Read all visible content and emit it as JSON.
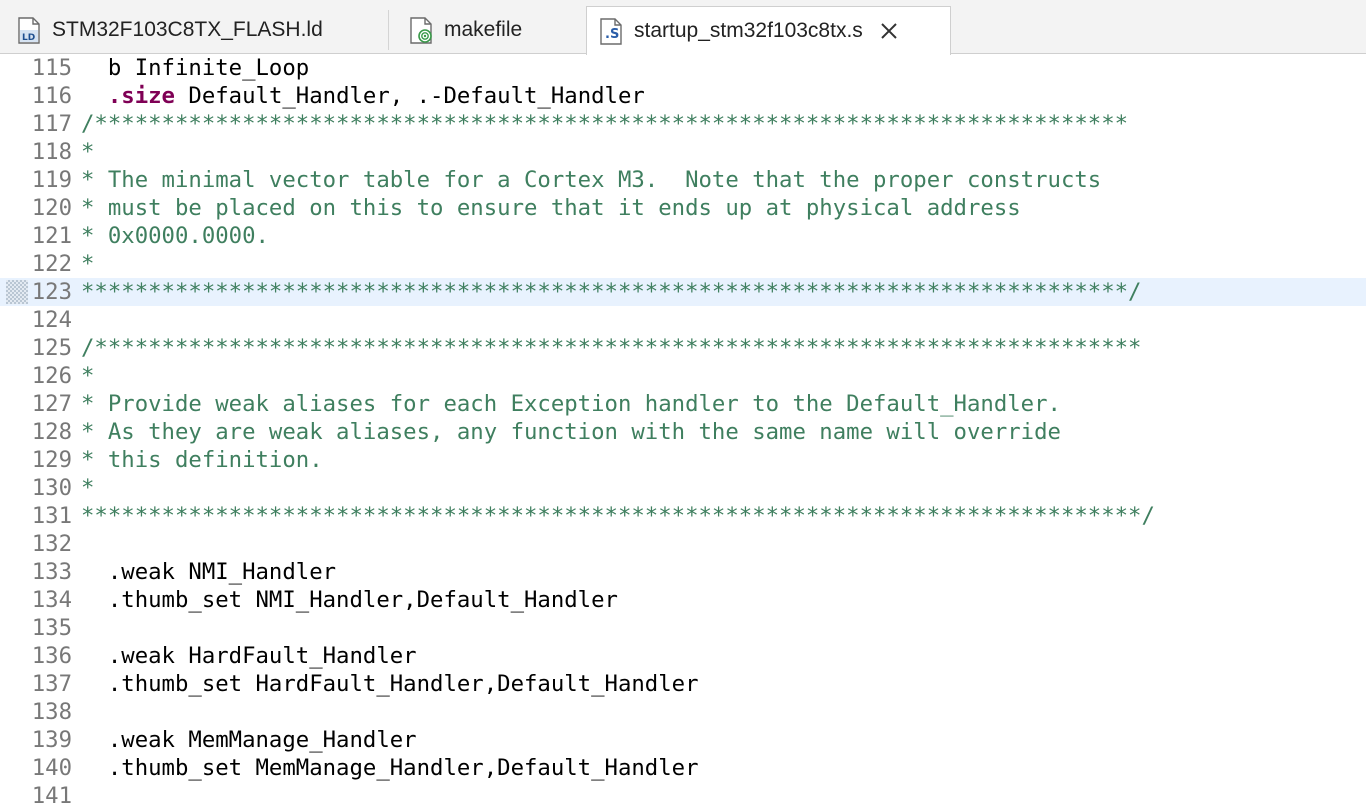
{
  "tabs": [
    {
      "label": "STM32F103C8TX_FLASH.ld",
      "icon": "linker-script-file-icon",
      "active": false
    },
    {
      "label": "makefile",
      "icon": "makefile-icon",
      "active": false
    },
    {
      "label": "startup_stm32f103c8tx.s",
      "icon": "assembly-file-icon",
      "active": true
    }
  ],
  "editor": {
    "current_line": "123",
    "colors": {
      "comment": "#3f7f5f",
      "keyword": "#7f0055",
      "line_number": "#787878",
      "current_line_bg": "#e8f2fe"
    },
    "lines": [
      {
        "num": "115",
        "text": "  b Infinite_Loop"
      },
      {
        "num": "116",
        "kw": ".size",
        "text": " Default_Handler, .-Default_Handler"
      },
      {
        "num": "117",
        "comment": "/*****************************************************************************"
      },
      {
        "num": "118",
        "comment": "*"
      },
      {
        "num": "119",
        "comment": "* The minimal vector table for a Cortex M3.  Note that the proper constructs"
      },
      {
        "num": "120",
        "comment": "* must be placed on this to ensure that it ends up at physical address"
      },
      {
        "num": "121",
        "comment": "* 0x0000.0000."
      },
      {
        "num": "122",
        "comment": "*"
      },
      {
        "num": "123",
        "comment": "******************************************************************************/"
      },
      {
        "num": "124",
        "text": ""
      },
      {
        "num": "125",
        "comment": "/******************************************************************************"
      },
      {
        "num": "126",
        "comment": "*"
      },
      {
        "num": "127",
        "comment": "* Provide weak aliases for each Exception handler to the Default_Handler."
      },
      {
        "num": "128",
        "comment": "* As they are weak aliases, any function with the same name will override"
      },
      {
        "num": "129",
        "comment": "* this definition."
      },
      {
        "num": "130",
        "comment": "*"
      },
      {
        "num": "131",
        "comment": "*******************************************************************************/"
      },
      {
        "num": "132",
        "text": ""
      },
      {
        "num": "133",
        "text": "  .weak NMI_Handler"
      },
      {
        "num": "134",
        "text": "  .thumb_set NMI_Handler,Default_Handler"
      },
      {
        "num": "135",
        "text": ""
      },
      {
        "num": "136",
        "text": "  .weak HardFault_Handler"
      },
      {
        "num": "137",
        "text": "  .thumb_set HardFault_Handler,Default_Handler"
      },
      {
        "num": "138",
        "text": ""
      },
      {
        "num": "139",
        "text": "  .weak MemManage_Handler"
      },
      {
        "num": "140",
        "text": "  .thumb_set MemManage_Handler,Default_Handler"
      },
      {
        "num": "141",
        "text": ""
      }
    ]
  }
}
